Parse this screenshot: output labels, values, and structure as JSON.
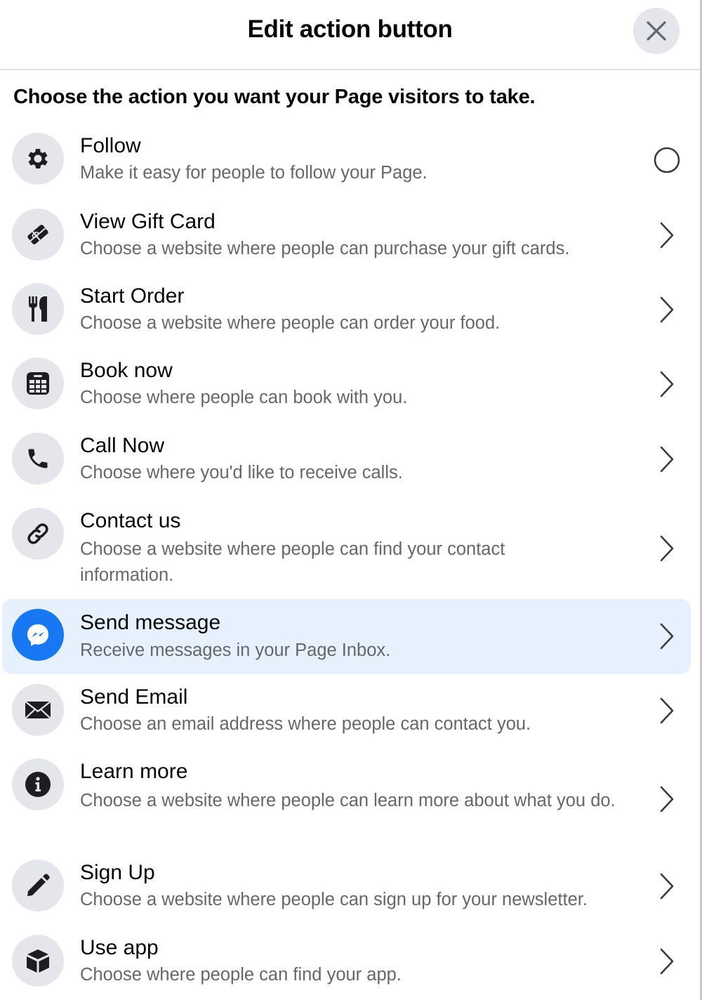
{
  "dialog": {
    "title": "Edit action button",
    "close_icon": "close-icon",
    "subtitle": "Choose the action you want your Page visitors to take."
  },
  "actions": [
    {
      "title": "Follow",
      "description": "Make it easy for people to follow your Page.",
      "icon": "gear-icon",
      "trailing": "radio",
      "selected": false
    },
    {
      "title": "View Gift Card",
      "description": "Choose a website where people can purchase your gift cards.",
      "icon": "gift-card-icon",
      "trailing": "chevron",
      "selected": false
    },
    {
      "title": "Start Order",
      "description": "Choose a website where people can order your food.",
      "icon": "fork-knife-icon",
      "trailing": "chevron",
      "selected": false
    },
    {
      "title": "Book now",
      "description": "Choose where people can book with you.",
      "icon": "calendar-icon",
      "trailing": "chevron",
      "selected": false
    },
    {
      "title": "Call Now",
      "description": "Choose where you'd like to receive calls.",
      "icon": "phone-icon",
      "trailing": "chevron",
      "selected": false
    },
    {
      "title": "Contact us",
      "description": "Choose a website where people can find your contact information.",
      "icon": "link-icon",
      "trailing": "chevron",
      "selected": false
    },
    {
      "title": "Send message",
      "description": "Receive messages in your Page Inbox.",
      "icon": "messenger-icon",
      "trailing": "chevron",
      "selected": true
    },
    {
      "title": "Send Email",
      "description": "Choose an email address where people can contact you.",
      "icon": "envelope-icon",
      "trailing": "chevron",
      "selected": false
    },
    {
      "title": "Learn more",
      "description": "Choose a website where people can learn more about what you do.",
      "icon": "info-icon",
      "trailing": "chevron",
      "selected": false
    },
    {
      "title": "Sign Up",
      "description": "Choose a website where people can sign up for your newsletter.",
      "icon": "pencil-icon",
      "trailing": "chevron",
      "selected": false
    },
    {
      "title": "Use app",
      "description": "Choose where people can find your app.",
      "icon": "cube-icon",
      "trailing": "chevron",
      "selected": false
    }
  ],
  "colors": {
    "accent": "#1877f2",
    "selected_bg": "#e7f0fd",
    "icon_bg": "#e4e6eb",
    "secondary_text": "#65676b"
  }
}
